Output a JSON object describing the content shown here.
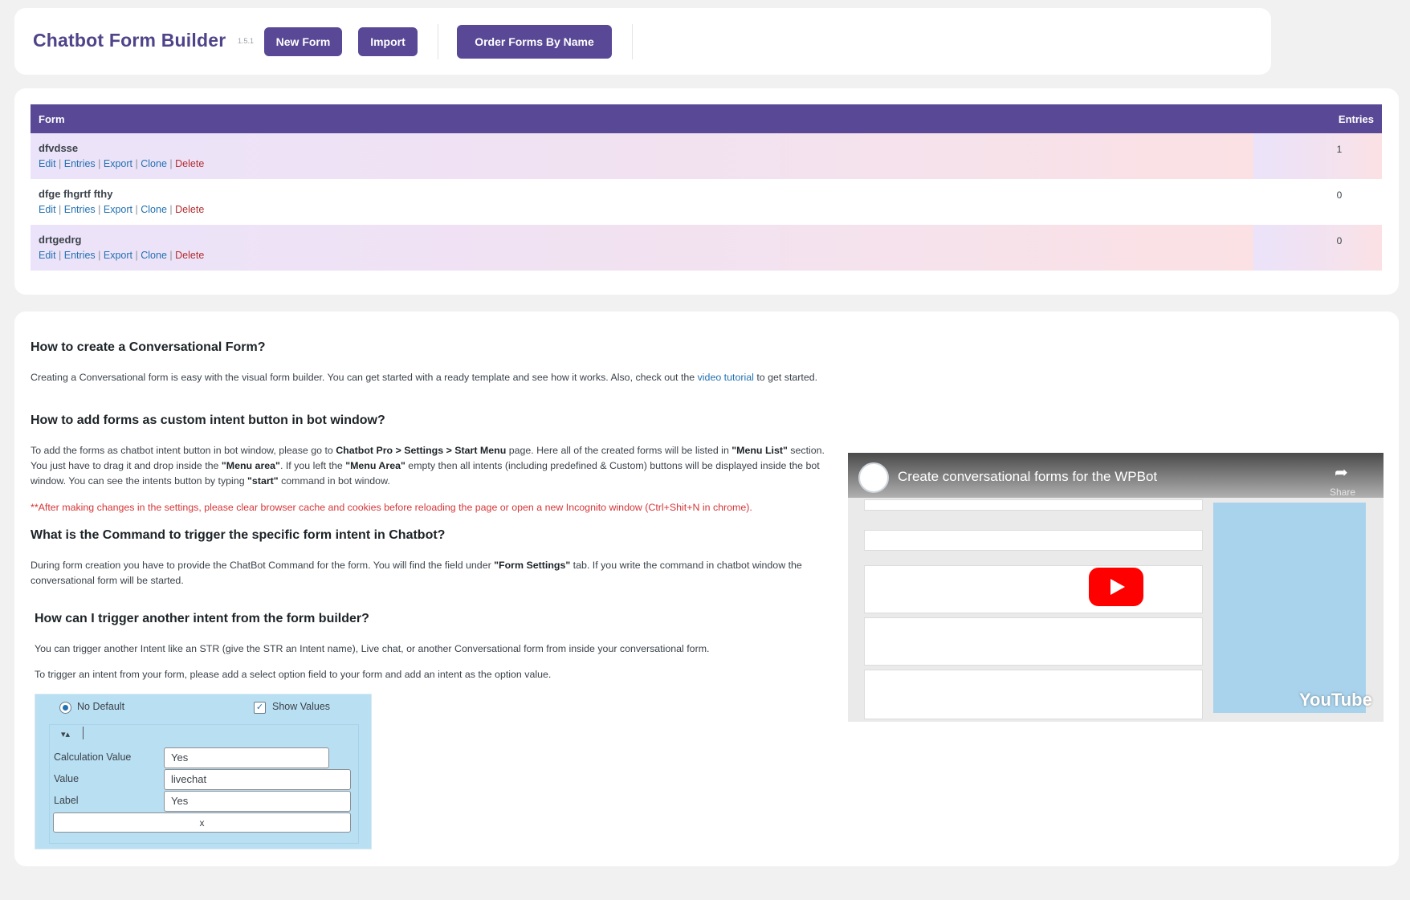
{
  "header": {
    "title": "Chatbot Form Builder",
    "version": "1.5.1",
    "new_form": "New Form",
    "import": "Import",
    "order_forms": "Order Forms By Name"
  },
  "table": {
    "col_form": "Form",
    "col_entries": "Entries",
    "actions": {
      "edit": "Edit",
      "entries": "Entries",
      "export": "Export",
      "clone": "Clone",
      "delete": "Delete",
      "sep": "|"
    },
    "rows": [
      {
        "name": "dfvdsse",
        "entries": "1"
      },
      {
        "name": "dfge fhgrtf fthy",
        "entries": "0"
      },
      {
        "name": "drtgedrg",
        "entries": "0"
      }
    ]
  },
  "help": {
    "h1": "How to create a Conversational Form?",
    "p1_a": "Creating a Conversational form is easy with the visual form builder. You can get started with a ready template and see how it works. Also, check out the ",
    "p1_link": "video tutorial",
    "p1_b": " to get started.",
    "h2": "How to add forms as custom intent button in bot window?",
    "p2_1": "To add the forms as chatbot intent button in bot window, please go to ",
    "p2_path": "Chatbot Pro > Settings > Start Menu",
    "p2_2": " page. Here all of the created forms will be listed in ",
    "p2_menu_list": "\"Menu List\"",
    "p2_3": " section. You just have to drag it and drop inside the ",
    "p2_menu_area": "\"Menu area\"",
    "p2_4": ". If you left the ",
    "p2_menu_area2": "\"Menu Area\"",
    "p2_5": " empty then all intents (including predefined & Custom) buttons will be displayed inside the bot window. You can see the intents button by typing ",
    "p2_start": "\"start\"",
    "p2_6": " command in bot window.",
    "warning": "**After making changes in the settings, please clear browser cache and cookies before reloading the page or open a new Incognito window (Ctrl+Shit+N in chrome).",
    "h3": "What is the Command to trigger the specific form intent in Chatbot?",
    "p3_1": "During form creation you have to provide the ChatBot Command for the form. You will find the field under ",
    "p3_tab": "\"Form Settings\"",
    "p3_2": " tab. If you write the command in chatbot window the conversational form will be started.",
    "h4": "How can I trigger another intent from the form builder?",
    "p4": "You can trigger another Intent like an STR (give the STR an Intent name), Live chat, or another Conversational form from inside your conversational form.",
    "p5": "To trigger an intent from your form, please add a select option field to your form and add an intent as the option value."
  },
  "mock": {
    "no_default": "No Default",
    "show_values": "Show Values",
    "sort_glyph": "▾▴",
    "calc_label": "Calculation Value",
    "calc_value": "Yes",
    "value_label": "Value",
    "value_value": "livechat",
    "label_label": "Label",
    "label_value": "Yes",
    "remove": "x"
  },
  "video": {
    "title": "Create conversational forms for the WPBot",
    "share": "Share",
    "brand": "YouTube",
    "share_glyph": "➦"
  }
}
